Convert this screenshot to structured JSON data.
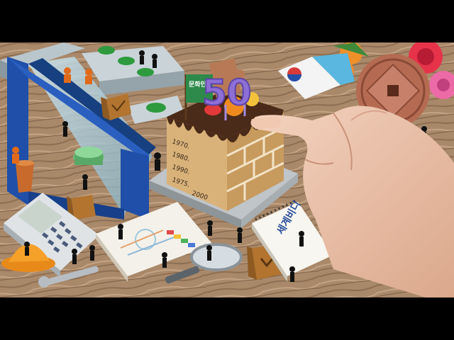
{
  "scene": {
    "candle_number": "50",
    "flag_text": "문화인구",
    "notebook_text": "세계비디",
    "cake_years": [
      "1970.",
      "1980.",
      "1990.",
      "1975.",
      "2000"
    ],
    "colors": {
      "wood": "#a9896a",
      "cake_sponge": "#d9b27a",
      "frosting": "#4a2a18",
      "candle": "#8e6fd6",
      "frame_blue": "#1f4fa8",
      "rose_red": "#e6334a",
      "coin": "#b56b52"
    },
    "icons": [
      "calculator-icon",
      "hard-hat-icon",
      "magnifier-icon",
      "wrench-icon",
      "hand-icon",
      "coin-icon",
      "flower-icon",
      "korean-flag-icon"
    ]
  }
}
